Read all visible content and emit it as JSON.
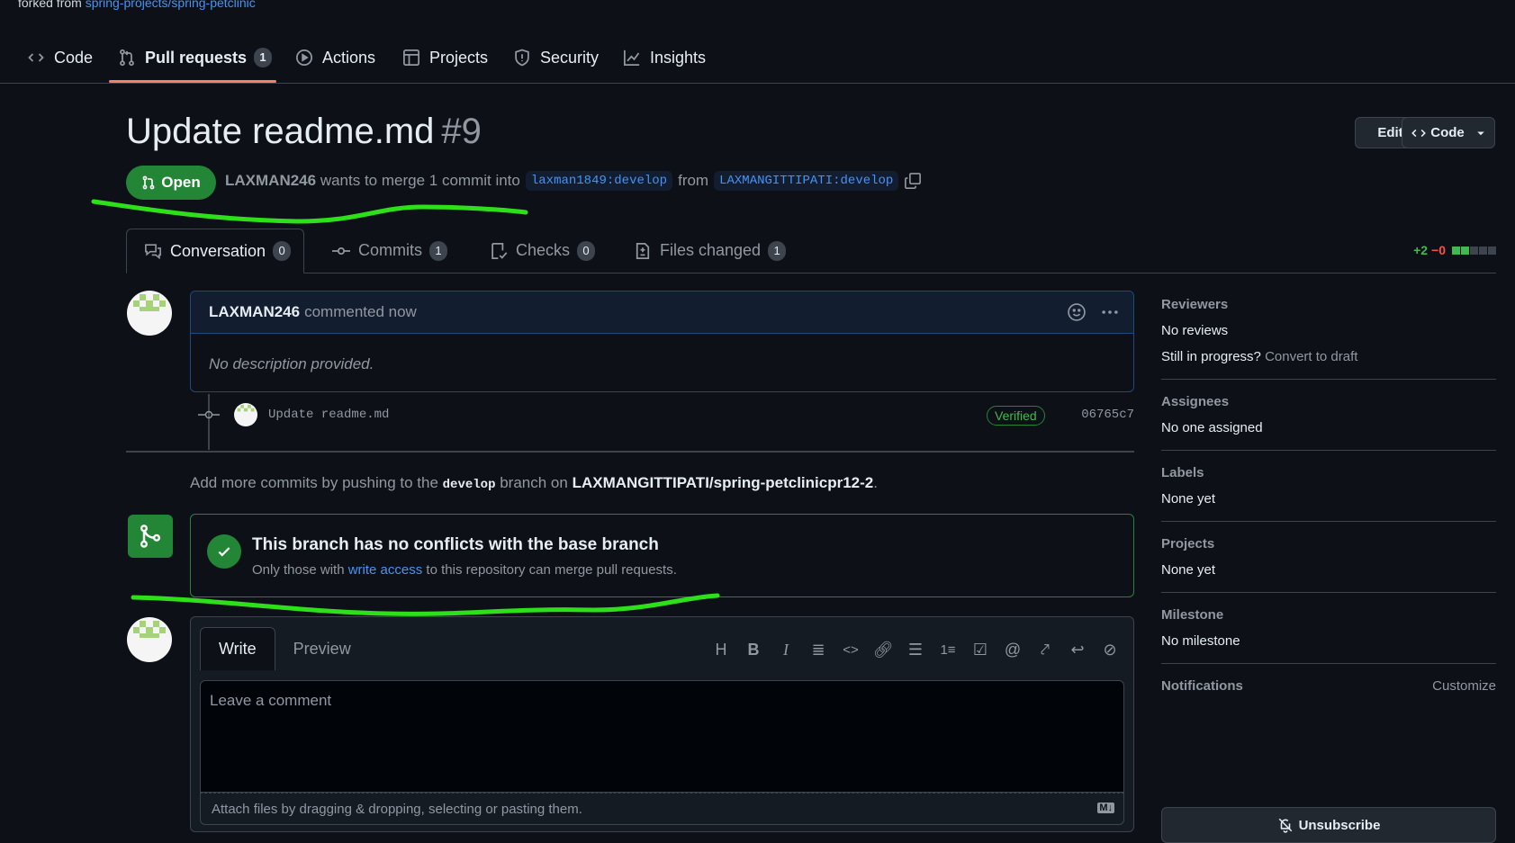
{
  "repo": {
    "forked_prefix": "forked from",
    "forked_link": "spring-projects/spring-petclinic"
  },
  "repo_nav": {
    "items": [
      {
        "label": "Code"
      },
      {
        "label": "Pull requests",
        "count": "1"
      },
      {
        "label": "Actions"
      },
      {
        "label": "Projects"
      },
      {
        "label": "Security"
      },
      {
        "label": "Insights"
      }
    ]
  },
  "pr": {
    "title": "Update readme.md",
    "number": "#9",
    "state": "Open",
    "author": "LAXMAN246",
    "merge_text": "wants to merge 1 commit into",
    "base_branch": "laxman1849:develop",
    "from_text": "from",
    "head_branch": "LAXMANGITTIPATI:develop",
    "edit_label": "Edit",
    "code_label": "Code"
  },
  "tabs": [
    {
      "label": "Conversation",
      "count": "0"
    },
    {
      "label": "Commits",
      "count": "1"
    },
    {
      "label": "Checks",
      "count": "0"
    },
    {
      "label": "Files changed",
      "count": "1"
    }
  ],
  "diffstat": {
    "additions": "+2",
    "deletions": "−0"
  },
  "comment": {
    "author": "LAXMAN246",
    "action": "commented now",
    "body": "No description provided."
  },
  "commit": {
    "message": "Update readme.md",
    "badge": "Verified",
    "sha": "06765c7"
  },
  "push_note": {
    "prefix": "Add more commits by pushing to the",
    "branch": "develop",
    "middle": "branch on",
    "repo": "LAXMANGITTIPATI/spring-petclinicpr12-2",
    "suffix": "."
  },
  "merge_status": {
    "title": "This branch has no conflicts with the base branch",
    "desc_prefix": "Only those with",
    "desc_link": "write access",
    "desc_suffix": "to this repository can merge pull requests."
  },
  "editor": {
    "tab_write": "Write",
    "tab_preview": "Preview",
    "placeholder": "Leave a comment",
    "attach_text": "Attach files by dragging & dropping, selecting or pasting them.",
    "toolbar_icons": [
      "heading-icon",
      "bold-icon",
      "italic-icon",
      "quote-icon",
      "code-icon",
      "link-icon",
      "unordered-list-icon",
      "ordered-list-icon",
      "task-list-icon",
      "mention-icon",
      "cross-reference-icon",
      "reply-icon",
      "slash-command-icon"
    ]
  },
  "sidebar": {
    "reviewers": {
      "heading": "Reviewers",
      "value": "No reviews",
      "progress_prefix": "Still in progress?",
      "progress_link": "Convert to draft"
    },
    "assignees": {
      "heading": "Assignees",
      "value": "No one assigned"
    },
    "labels": {
      "heading": "Labels",
      "value": "None yet"
    },
    "projects": {
      "heading": "Projects",
      "value": "None yet"
    },
    "milestone": {
      "heading": "Milestone",
      "value": "No milestone"
    },
    "notifications": {
      "heading": "Notifications",
      "customize": "Customize",
      "button": "Unsubscribe"
    }
  },
  "colors": {
    "accent_green": "#238636",
    "link_blue": "#4493f8",
    "annotation_green": "#2ee01a",
    "tab_underline": "#f78166"
  }
}
